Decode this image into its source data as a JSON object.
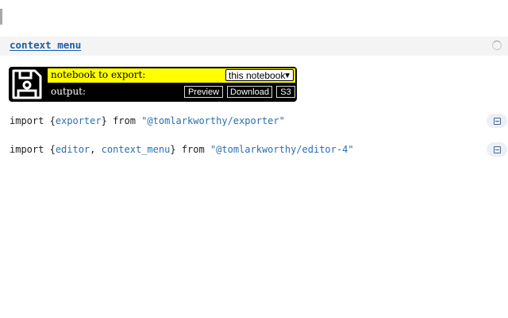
{
  "cell_header": {
    "link_text": "context_menu"
  },
  "exporter": {
    "notebook_label": "notebook to export:",
    "notebook_select_value": "this notebook",
    "output_label": "output:",
    "buttons": {
      "preview": "Preview",
      "download": "Download",
      "s3": "S3"
    },
    "row_highlight_color": "#ffff00"
  },
  "code": {
    "line1": {
      "kw_import": "import ",
      "brace_open": "{",
      "ident1": "exporter",
      "brace_close": "}",
      "kw_from": " from ",
      "module": "\"@tomlarkworthy/exporter\""
    },
    "line2": {
      "kw_import": "import ",
      "brace_open": "{",
      "ident1": "editor",
      "sep": ", ",
      "ident2": "context_menu",
      "brace_close": "}",
      "kw_from": " from ",
      "module": "\"@tomlarkworthy/editor-4\""
    }
  },
  "icons": {
    "save": "floppy-disk-icon",
    "spinner": "loading-spinner-icon",
    "collapse": "collapse-cell-icon"
  }
}
